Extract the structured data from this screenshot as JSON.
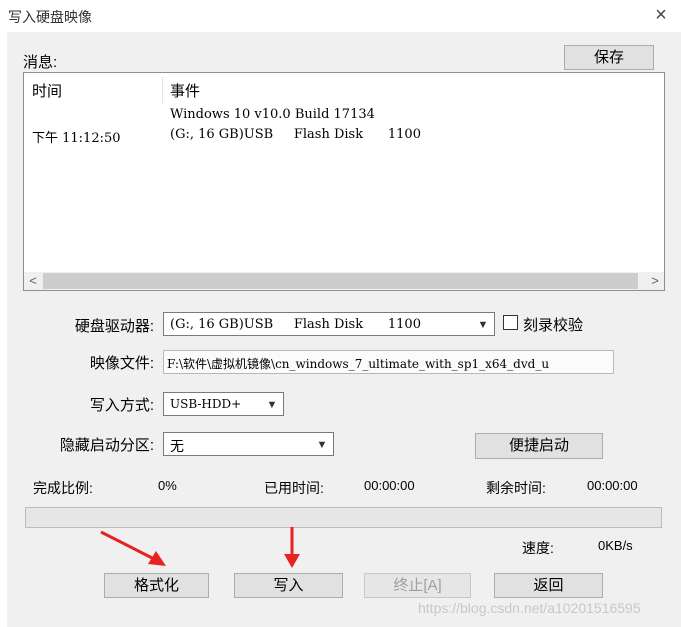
{
  "window": {
    "title": "写入硬盘映像",
    "close_glyph": "×"
  },
  "messages": {
    "label": "消息:",
    "save_button": "保存",
    "columns": {
      "time": "时间",
      "event": "事件"
    },
    "rows": [
      {
        "time": "",
        "event": "Windows 10 v10.0 Build 17134"
      },
      {
        "time": "下午 11:12:50",
        "event": "(G:, 16 GB)USB     Flash Disk      1100"
      }
    ],
    "scroll_left": "<",
    "scroll_right": ">"
  },
  "form": {
    "drive_label": "硬盘驱动器:",
    "drive_value": "(G:, 16 GB)USB     Flash Disk      1100",
    "verify_label": "刻录校验",
    "verify_checked": false,
    "image_label": "映像文件:",
    "image_value": "F:\\软件\\虚拟机镜像\\cn_windows_7_ultimate_with_sp1_x64_dvd_u",
    "write_mode_label": "写入方式:",
    "write_mode_value": "USB-HDD+",
    "hidden_partition_label": "隐藏启动分区:",
    "hidden_partition_value": "无",
    "quick_boot_button": "便捷启动"
  },
  "status": {
    "completion_label": "完成比例:",
    "completion_value": "0%",
    "progress": 0,
    "elapsed_label": "已用时间:",
    "elapsed_value": "00:00:00",
    "remaining_label": "剩余时间:",
    "remaining_value": "00:00:00",
    "speed_label": "速度:",
    "speed_value": "0KB/s"
  },
  "buttons": {
    "format": "格式化",
    "write": "写入",
    "stop": "终止[A]",
    "back": "返回"
  },
  "watermark": "https://blog.csdn.net/a10201516595",
  "colors": {
    "annotation_arrow": "#e8231f",
    "background": "#f0f0f0"
  }
}
